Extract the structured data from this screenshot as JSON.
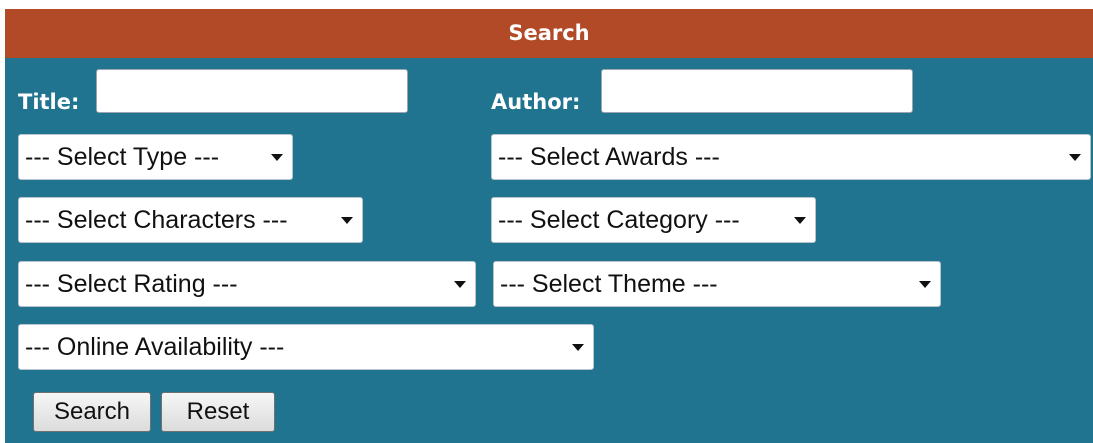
{
  "panel": {
    "title": "Search",
    "colors": {
      "header": "#b24a27",
      "body": "#207490",
      "text": "#ffffff"
    }
  },
  "fields": {
    "title_label": "Title:",
    "title_value": "",
    "author_label": "Author:",
    "author_value": ""
  },
  "selects": {
    "type": "--- Select Type ---",
    "awards": "--- Select Awards ---",
    "characters": "--- Select Characters ---",
    "category": "--- Select Category ---",
    "rating": "--- Select Rating ---",
    "theme": "--- Select Theme ---",
    "online": "--- Online Availability ---"
  },
  "buttons": {
    "search": "Search",
    "reset": "Reset"
  },
  "icons": {
    "dropdown": "chevron-down-icon"
  }
}
